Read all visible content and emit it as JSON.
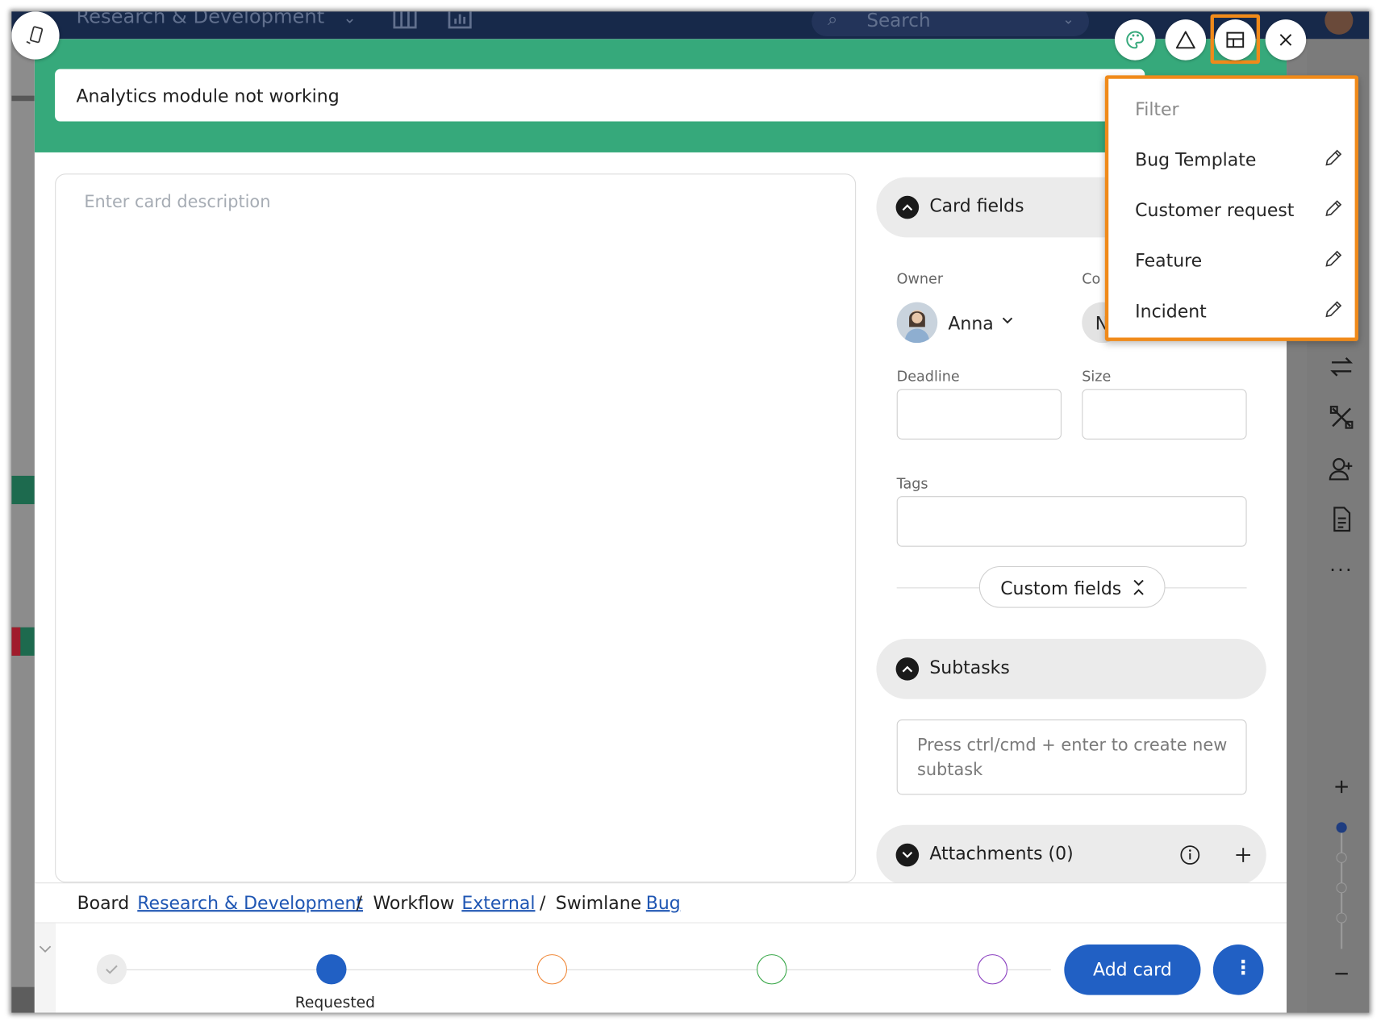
{
  "app_bar": {
    "board_name": "Research & Development",
    "search_placeholder": "Search"
  },
  "card": {
    "title": "Analytics module not working",
    "description_placeholder": "Enter card description"
  },
  "card_fields": {
    "section_label": "Card fields",
    "owner_label": "Owner",
    "owner_name": "Anna",
    "co_owner_label_partial": "Co",
    "co_owner_avatar_partial": "N",
    "deadline_label": "Deadline",
    "size_label": "Size",
    "tags_label": "Tags",
    "custom_fields_label": "Custom fields"
  },
  "subtasks": {
    "section_label": "Subtasks",
    "input_placeholder": "Press ctrl/cmd + enter to create new subtask"
  },
  "attachments": {
    "section_label": "Attachments (0)"
  },
  "breadcrumb": {
    "board_label": "Board",
    "board_link": "Research & Development",
    "sep1": "/",
    "workflow_label": "Workflow",
    "workflow_link": "External",
    "sep2": "/",
    "swimlane_label": "Swimlane",
    "swimlane_link": "Bug"
  },
  "progress": {
    "current_stage": "Requested",
    "stage_colors": [
      "#cfcfcf",
      "#2160c4",
      "#f08a3c",
      "#3aa84a",
      "#8a3fc0"
    ]
  },
  "actions": {
    "add_card": "Add card",
    "more": "⋮"
  },
  "template_menu": {
    "filter_placeholder": "Filter",
    "items": [
      {
        "label": "Bug Template"
      },
      {
        "label": "Customer request"
      },
      {
        "label": "Feature"
      },
      {
        "label": "Incident"
      }
    ]
  },
  "colors": {
    "header_green": "#36a97b",
    "app_bar": "#17294a",
    "accent_blue": "#2160c4",
    "highlight_orange": "#f08a1a",
    "link_blue": "#1f56b3"
  }
}
